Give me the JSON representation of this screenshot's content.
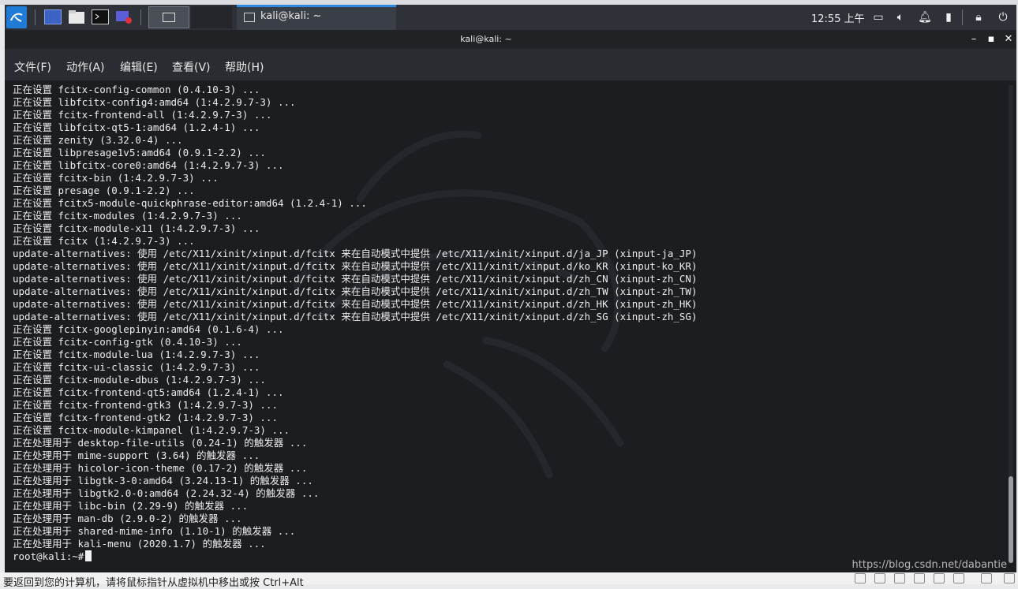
{
  "panel": {
    "taskbar_title": "kali@kali: ~",
    "clock": "12:55 上午"
  },
  "window": {
    "title": "kali@kali: ~",
    "menus": [
      "文件(F)",
      "动作(A)",
      "编辑(E)",
      "查看(V)",
      "帮助(H)"
    ]
  },
  "terminal": {
    "lines": [
      "正在设置 fcitx-config-common (0.4.10-3) ...",
      "正在设置 libfcitx-config4:amd64 (1:4.2.9.7-3) ...",
      "正在设置 fcitx-frontend-all (1:4.2.9.7-3) ...",
      "正在设置 libfcitx-qt5-1:amd64 (1.2.4-1) ...",
      "正在设置 zenity (3.32.0-4) ...",
      "正在设置 libpresage1v5:amd64 (0.9.1-2.2) ...",
      "正在设置 libfcitx-core0:amd64 (1:4.2.9.7-3) ...",
      "正在设置 fcitx-bin (1:4.2.9.7-3) ...",
      "正在设置 presage (0.9.1-2.2) ...",
      "正在设置 fcitx5-module-quickphrase-editor:amd64 (1.2.4-1) ...",
      "正在设置 fcitx-modules (1:4.2.9.7-3) ...",
      "正在设置 fcitx-module-x11 (1:4.2.9.7-3) ...",
      "正在设置 fcitx (1:4.2.9.7-3) ...",
      "update-alternatives: 使用 /etc/X11/xinit/xinput.d/fcitx 来在自动模式中提供 /etc/X11/xinit/xinput.d/ja_JP (xinput-ja_JP)",
      "update-alternatives: 使用 /etc/X11/xinit/xinput.d/fcitx 来在自动模式中提供 /etc/X11/xinit/xinput.d/ko_KR (xinput-ko_KR)",
      "update-alternatives: 使用 /etc/X11/xinit/xinput.d/fcitx 来在自动模式中提供 /etc/X11/xinit/xinput.d/zh_CN (xinput-zh_CN)",
      "update-alternatives: 使用 /etc/X11/xinit/xinput.d/fcitx 来在自动模式中提供 /etc/X11/xinit/xinput.d/zh_TW (xinput-zh_TW)",
      "update-alternatives: 使用 /etc/X11/xinit/xinput.d/fcitx 来在自动模式中提供 /etc/X11/xinit/xinput.d/zh_HK (xinput-zh_HK)",
      "update-alternatives: 使用 /etc/X11/xinit/xinput.d/fcitx 来在自动模式中提供 /etc/X11/xinit/xinput.d/zh_SG (xinput-zh_SG)",
      "正在设置 fcitx-googlepinyin:amd64 (0.1.6-4) ...",
      "正在设置 fcitx-config-gtk (0.4.10-3) ...",
      "正在设置 fcitx-module-lua (1:4.2.9.7-3) ...",
      "正在设置 fcitx-ui-classic (1:4.2.9.7-3) ...",
      "正在设置 fcitx-module-dbus (1:4.2.9.7-3) ...",
      "正在设置 fcitx-frontend-qt5:amd64 (1.2.4-1) ...",
      "正在设置 fcitx-frontend-gtk3 (1:4.2.9.7-3) ...",
      "正在设置 fcitx-frontend-gtk2 (1:4.2.9.7-3) ...",
      "正在设置 fcitx-module-kimpanel (1:4.2.9.7-3) ...",
      "正在处理用于 desktop-file-utils (0.24-1) 的触发器 ...",
      "正在处理用于 mime-support (3.64) 的触发器 ...",
      "正在处理用于 hicolor-icon-theme (0.17-2) 的触发器 ...",
      "正在处理用于 libgtk-3-0:amd64 (3.24.13-1) 的触发器 ...",
      "正在处理用于 libgtk2.0-0:amd64 (2.24.32-4) 的触发器 ...",
      "正在处理用于 libc-bin (2.29-9) 的触发器 ...",
      "正在处理用于 man-db (2.9.0-2) 的触发器 ...",
      "正在处理用于 shared-mime-info (1.10-1) 的触发器 ...",
      "正在处理用于 kali-menu (2020.1.7) 的触发器 ..."
    ],
    "prompt": "root@kali:~#"
  },
  "watermark": "https://blog.csdn.net/dabantie",
  "host_status": "要返回到您的计算机，请将鼠标指针从虚拟机中移出或按 Ctrl+Alt"
}
